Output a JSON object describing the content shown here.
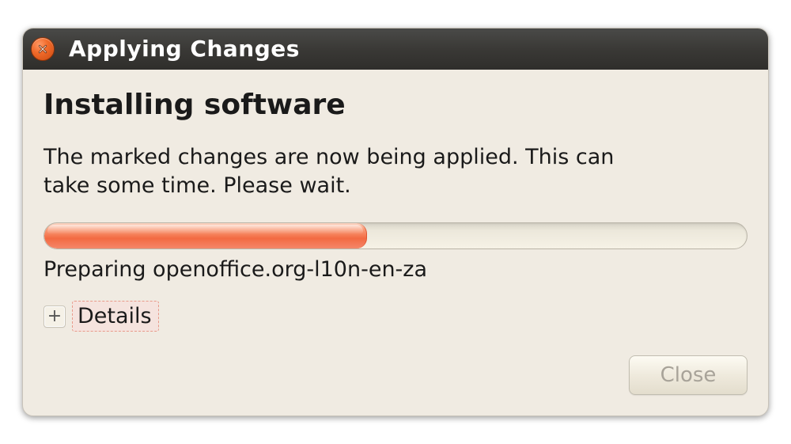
{
  "titlebar": {
    "title": "Applying Changes"
  },
  "content": {
    "heading": "Installing software",
    "description": "The marked changes are now being applied. This can take some time. Please wait.",
    "progress_percent": 46,
    "status": "Preparing openoffice.org-l10n-en-za",
    "expander_glyph": "+",
    "details_label": "Details",
    "close_label": "Close"
  }
}
